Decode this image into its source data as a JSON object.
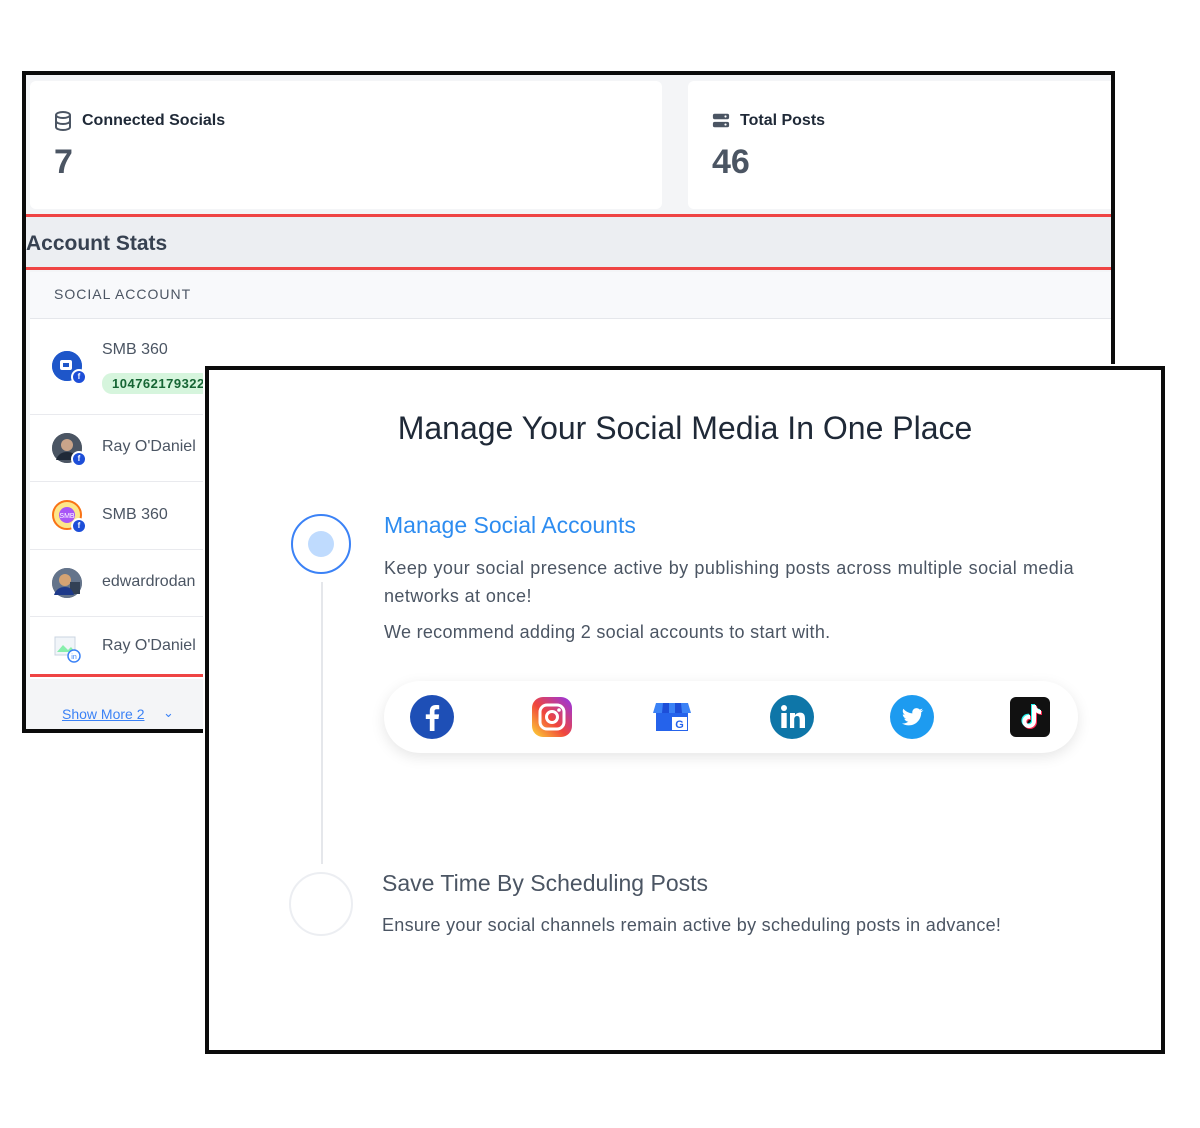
{
  "stats": {
    "connected": {
      "label": "Connected Socials",
      "value": "7",
      "icon": "database-icon"
    },
    "posts": {
      "label": "Total Posts",
      "value": "46",
      "icon": "server-icon"
    }
  },
  "account_stats": {
    "title": "Account Stats",
    "column_header": "SOCIAL ACCOUNT",
    "rows": [
      {
        "name": "SMB 360",
        "id": "104762179322"
      },
      {
        "name": "Ray O'Daniel"
      },
      {
        "name": "SMB 360"
      },
      {
        "name": "edwardrodan"
      },
      {
        "name": "Ray O'Daniel"
      }
    ],
    "show_more": "Show More 2"
  },
  "onboarding": {
    "title": "Manage Your Social Media In One Place",
    "step1": {
      "title": "Manage Social Accounts",
      "description": "Keep your social presence active by publishing posts across multiple social media networks at once!",
      "recommendation": "We recommend adding 2 social accounts to start with."
    },
    "socials": [
      "facebook-icon",
      "instagram-icon",
      "google-business-icon",
      "linkedin-icon",
      "twitter-icon",
      "tiktok-icon"
    ],
    "step2": {
      "title": "Save Time By Scheduling Posts",
      "description": "Ensure your social channels remain active by scheduling posts in advance!"
    }
  },
  "colors": {
    "accent": "#2d8cf0",
    "highlight": "#ef4444",
    "pill": "#d6f5dd"
  }
}
